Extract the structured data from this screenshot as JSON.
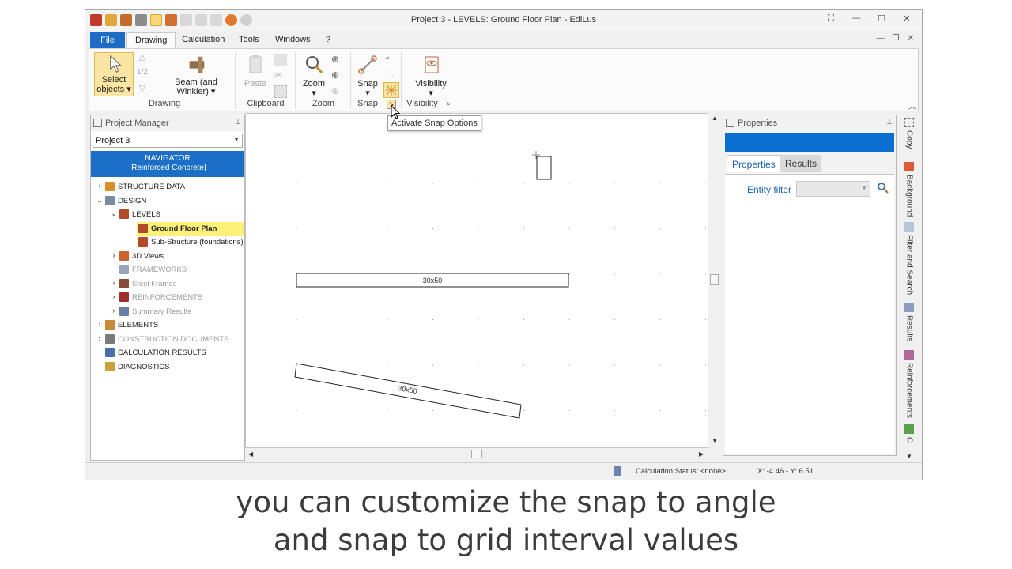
{
  "window": {
    "title": "Project 3 -  LEVELS: Ground Floor Plan - EdiLus"
  },
  "ribbon_tabs": [
    "File",
    "Drawing",
    "Calculation",
    "Tools",
    "Windows",
    "?"
  ],
  "ribbon": {
    "select_label_1": "Select",
    "select_label_2": "objects",
    "fraction": "1/2",
    "beam_label_1": "Beam (and",
    "beam_label_2": "Winkler)",
    "paste_label": "Paste",
    "zoom_label": "Zoom",
    "snap_label": "Snap",
    "visibility_label": "Visibility",
    "groups": [
      "Drawing",
      "Clipboard",
      "Zoom",
      "Snap",
      "Visibility"
    ]
  },
  "tooltip": "Activate Snap Options",
  "project_manager": {
    "title": "Project Manager",
    "project_select": "Project 3",
    "navigator_line1": "NAVIGATOR",
    "navigator_line2": "[Reinforced Concrete]",
    "tree": [
      {
        "label": "STRUCTURE DATA",
        "level": 0,
        "expander": ">",
        "disabled": false,
        "selected": false,
        "color": "#d9902a"
      },
      {
        "label": "DESIGN",
        "level": 0,
        "expander": "v",
        "disabled": false,
        "selected": false,
        "color": "#7a8aa0"
      },
      {
        "label": "LEVELS",
        "level": 1,
        "expander": "v",
        "disabled": false,
        "selected": false,
        "color": "#b34a2a"
      },
      {
        "label": "Ground Floor Plan",
        "level": 2,
        "expander": "",
        "disabled": false,
        "selected": true,
        "color": "#b34a2a"
      },
      {
        "label": "Sub-Structure (foundations)",
        "level": 2,
        "expander": "",
        "disabled": false,
        "selected": false,
        "color": "#b34a2a"
      },
      {
        "label": "3D Views",
        "level": 1,
        "expander": ">",
        "disabled": false,
        "selected": false,
        "color": "#c8642a"
      },
      {
        "label": "FRAMEWORKS",
        "level": 1,
        "expander": "",
        "disabled": true,
        "selected": false,
        "color": "#9aa6b8"
      },
      {
        "label": "Steel Frames",
        "level": 1,
        "expander": ">",
        "disabled": true,
        "selected": false,
        "color": "#8a4a3a"
      },
      {
        "label": "REINFORCEMENTS",
        "level": 1,
        "expander": ">",
        "disabled": true,
        "selected": false,
        "color": "#a03030"
      },
      {
        "label": "Summary Results",
        "level": 1,
        "expander": ">",
        "disabled": true,
        "selected": false,
        "color": "#6a7fa8"
      },
      {
        "label": "ELEMENTS",
        "level": 0,
        "expander": ">",
        "disabled": false,
        "selected": false,
        "color": "#c88a3a"
      },
      {
        "label": "CONSTRUCTION DOCUMENTS",
        "level": 0,
        "expander": ">",
        "disabled": true,
        "selected": false,
        "color": "#7a7a7a"
      },
      {
        "label": "CALCULATION RESULTS",
        "level": 0,
        "expander": "",
        "disabled": false,
        "selected": false,
        "color": "#4a6fa8"
      },
      {
        "label": "DIAGNOSTICS",
        "level": 0,
        "expander": "",
        "disabled": false,
        "selected": false,
        "color": "#c8a23a"
      }
    ]
  },
  "canvas": {
    "beam1_label": "30x50",
    "beam2_label": "30x50"
  },
  "properties": {
    "title": "Properties",
    "tab_properties": "Properties",
    "tab_results": "Results",
    "entity_filter": "Entity filter"
  },
  "side_tabs": [
    "Copy",
    "Background",
    "Filter and Search",
    "Results",
    "Reinforcements",
    "C"
  ],
  "status": {
    "calc_status": "Calculation Status: <none>",
    "coords": "X: -4.46 - Y: 6.51"
  },
  "caption": {
    "line1": "you can customize the snap to angle",
    "line2": "and snap to grid interval values"
  }
}
